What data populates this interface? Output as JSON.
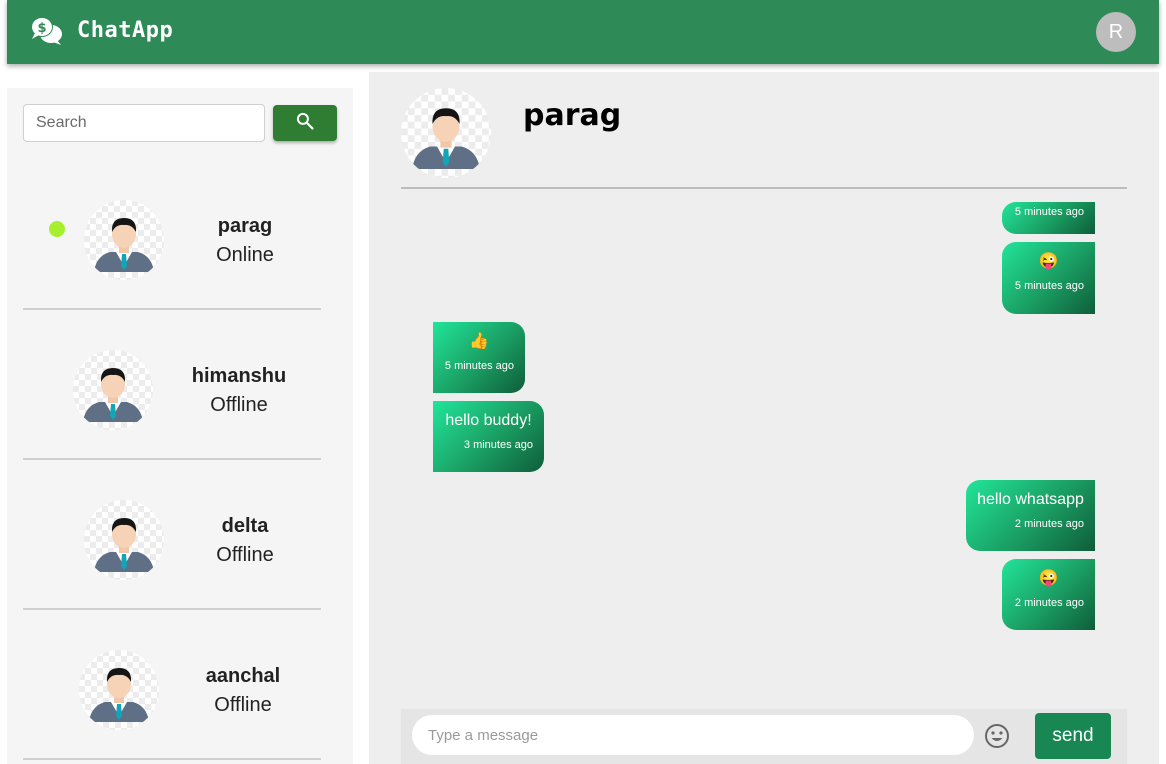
{
  "app": {
    "title": "ChatApp",
    "user_initial": "R",
    "icon": "chat-bubbles-dollar-icon"
  },
  "search": {
    "placeholder": "Search",
    "icon": "search-icon"
  },
  "contacts": [
    {
      "name": "parag",
      "status": "Online",
      "online": true
    },
    {
      "name": "himanshu",
      "status": "Offline",
      "online": false
    },
    {
      "name": "delta",
      "status": "Offline",
      "online": false
    },
    {
      "name": "aanchal",
      "status": "Offline",
      "online": false
    }
  ],
  "chat": {
    "name": "parag",
    "messages": [
      {
        "direction": "out",
        "text": "",
        "time": "5 minutes ago"
      },
      {
        "direction": "out",
        "text": "😜",
        "time": "5 minutes ago"
      },
      {
        "direction": "in",
        "text": "👍",
        "time": "5 minutes ago"
      },
      {
        "direction": "in",
        "text": "hello buddy!",
        "time": "3 minutes ago"
      },
      {
        "direction": "out",
        "text": "hello whatsapp",
        "time": "2 minutes ago"
      },
      {
        "direction": "out",
        "text": "😜",
        "time": "2 minutes ago"
      }
    ]
  },
  "composer": {
    "placeholder": "Type a message",
    "send_label": "send",
    "emoji_icon": "smiley-icon"
  },
  "colors": {
    "appbar": "#2e8b57",
    "online_dot": "#a6ef2d",
    "search_button": "#2e7d32",
    "send_button": "#198754",
    "bubble_start": "#22e59a",
    "bubble_end": "#0f5d3a"
  }
}
